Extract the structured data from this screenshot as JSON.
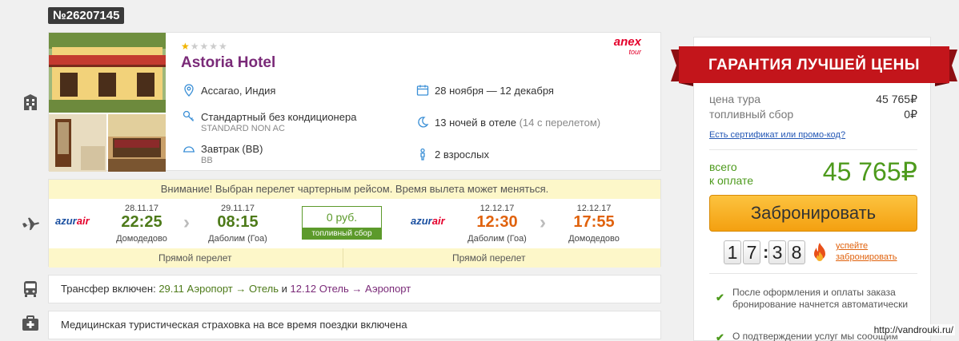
{
  "order": {
    "number": "№26207145"
  },
  "hotel": {
    "stars_rating": 1,
    "stars_max": 5,
    "name": "Astoria Hotel",
    "operator_logo": {
      "main": "anex",
      "sub": "tour"
    },
    "location": "Ассагао, Индия",
    "room": "Стандартный без кондиционера",
    "room_code": "STANDARD NON AC",
    "meal": "Завтрак (BB)",
    "meal_code": "BB",
    "dates": "28 ноября — 12 декабря",
    "nights": "13 ночей в отеле",
    "nights_extra": "(14 с перелетом)",
    "guests": "2 взрослых"
  },
  "flight": {
    "warning": "Внимание! Выбран перелет чартерным рейсом. Время вылета может меняться.",
    "airline": {
      "main": "azur",
      "accent": "air"
    },
    "outbound": {
      "dep_date": "28.11.17",
      "dep_time": "22:25",
      "dep_city": "Домодедово",
      "arr_date": "29.11.17",
      "arr_time": "08:15",
      "arr_city": "Даболим (Гоа)",
      "direct": "Прямой перелет"
    },
    "fee": {
      "value": "0 руб.",
      "label": "топливный сбор"
    },
    "return": {
      "dep_date": "12.12.17",
      "dep_time": "12:30",
      "dep_city": "Даболим (Гоа)",
      "arr_date": "12.12.17",
      "arr_time": "17:55",
      "arr_city": "Домодедово",
      "direct": "Прямой перелет"
    }
  },
  "transfer": {
    "prefix": "Трансфер включен:",
    "out": "29.11 Аэропорт → Отель",
    "and": "и",
    "ret": "12.12 Отель → Аэропорт"
  },
  "insurance": {
    "text": "Медицинская туристическая страховка на все время поездки включена"
  },
  "price": {
    "banner": "ГАРАНТИЯ ЛУЧШЕЙ ЦЕНЫ",
    "tour_label": "цена тура",
    "tour_value": "45 765₽",
    "fuel_label": "топливный сбор",
    "fuel_value": "0₽",
    "promo_link": "Есть сертификат или промо-код?",
    "total_label_1": "всего",
    "total_label_2": "к оплате",
    "total_value": "45 765₽",
    "book_button": "Забронировать",
    "timer": [
      "1",
      "7",
      "3",
      "8"
    ],
    "hurry_1": "успейте",
    "hurry_2": "забронировать",
    "note_1": "После оформления и оплаты заказа бронирование начнется автоматически",
    "note_2": "О подтверждении услуг мы сообщим"
  },
  "watermark": "http://vandrouki.ru/",
  "colors": {
    "hotel_name": "#7a2a78",
    "green": "#4d7a19",
    "orange": "#e0620d",
    "ribbon": "#c3151b",
    "button": "#f4a010"
  }
}
